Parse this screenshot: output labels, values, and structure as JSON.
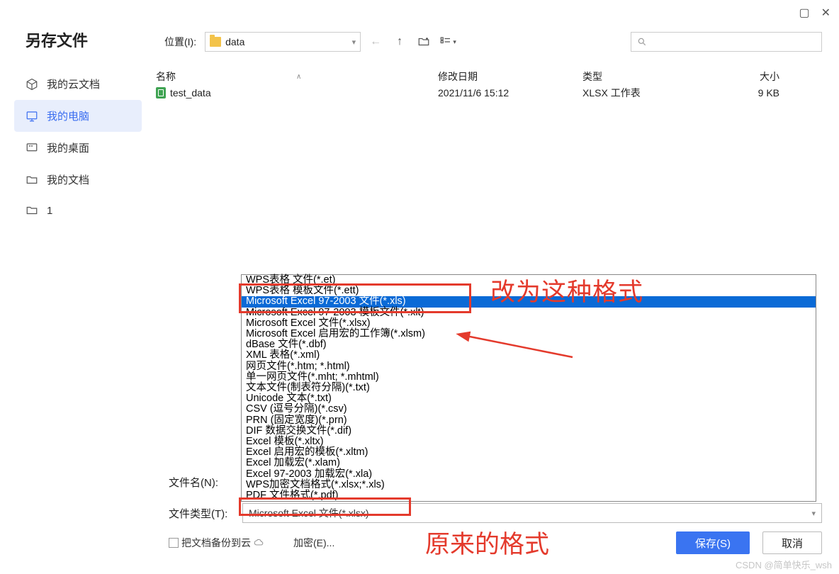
{
  "window": {
    "title": "另存文件"
  },
  "sidebar": {
    "items": [
      {
        "label": "我的云文档"
      },
      {
        "label": "我的电脑"
      },
      {
        "label": "我的桌面"
      },
      {
        "label": "我的文档"
      },
      {
        "label": "1"
      }
    ]
  },
  "toolbar": {
    "location_label": "位置(I):",
    "path": "data"
  },
  "columns": {
    "name": "名称",
    "date": "修改日期",
    "type": "类型",
    "size": "大小"
  },
  "files": [
    {
      "name": "test_data",
      "date": "2021/11/6 15:12",
      "type": "XLSX 工作表",
      "size": "9 KB"
    }
  ],
  "dropdown": {
    "options": [
      "WPS表格 文件(*.et)",
      "WPS表格 模板文件(*.ett)",
      "Microsoft Excel 97-2003 文件(*.xls)",
      "Microsoft Excel 97-2003 模板文件(*.xlt)",
      "Microsoft Excel 文件(*.xlsx)",
      "Microsoft Excel 启用宏的工作簿(*.xlsm)",
      "dBase 文件(*.dbf)",
      "XML 表格(*.xml)",
      "网页文件(*.htm; *.html)",
      "单一网页文件(*.mht; *.mhtml)",
      "文本文件(制表符分隔)(*.txt)",
      "Unicode 文本(*.txt)",
      "CSV (逗号分隔)(*.csv)",
      "PRN (固定宽度)(*.prn)",
      "DIF 数据交换文件(*.dif)",
      "Excel 模板(*.xltx)",
      "Excel 启用宏的模板(*.xltm)",
      "Excel 加载宏(*.xlam)",
      "Excel 97-2003 加载宏(*.xla)",
      "WPS加密文档格式(*.xlsx;*.xls)",
      "PDF 文件格式(*.pdf)"
    ],
    "selected_index": 2
  },
  "form": {
    "filename_label": "文件名(N):",
    "filetype_label": "文件类型(T):",
    "filetype_value": "Microsoft Excel 文件(*.xlsx)"
  },
  "bottom": {
    "backup_label": "把文档备份到云",
    "encrypt_label": "加密(E)...",
    "save_label": "保存(S)",
    "cancel_label": "取消"
  },
  "annotations": {
    "text1": "改为这种格式",
    "text2": "原来的格式"
  },
  "watermark": "CSDN @简单快乐_wsh"
}
